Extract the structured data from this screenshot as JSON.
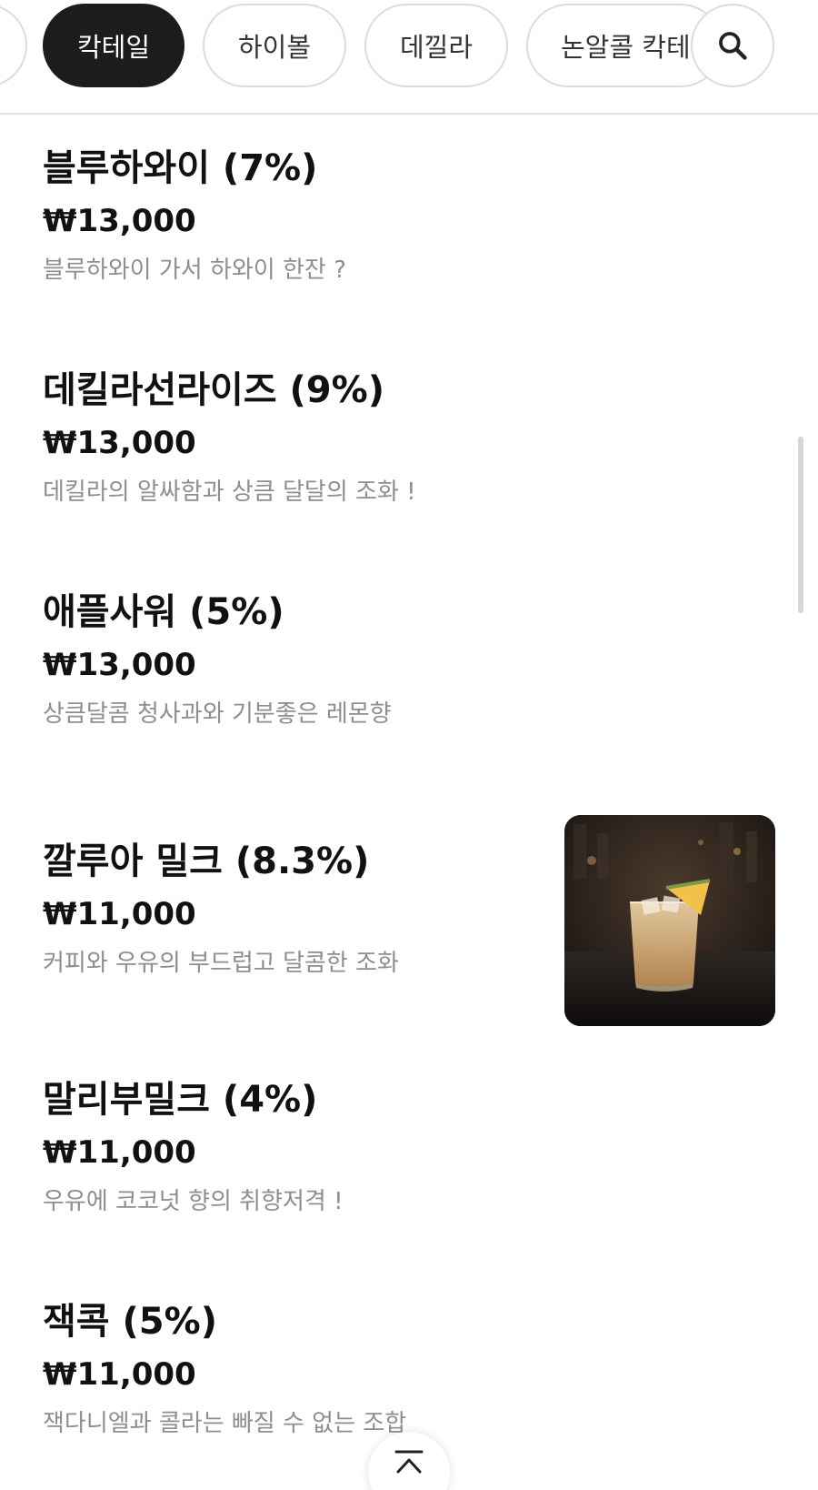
{
  "categories": [
    {
      "label": ""
    },
    {
      "label": "칵테일",
      "active": true
    },
    {
      "label": "하이볼"
    },
    {
      "label": "데낄라"
    },
    {
      "label": "논알콜 칵테"
    }
  ],
  "search": {
    "icon": "search-icon"
  },
  "menu": [
    {
      "name": "블루하와이 (7%)",
      "price": "₩13,000",
      "desc": "블루하와이 가서 하와이 한잔 ?"
    },
    {
      "name": "데킬라선라이즈 (9%)",
      "price": "₩13,000",
      "desc": "데킬라의 알싸함과 상큼 달달의 조화 !"
    },
    {
      "name": "애플사워 (5%)",
      "price": "₩13,000",
      "desc": "상큼달콤 청사과와 기분좋은 레몬향"
    },
    {
      "name": "깔루아 밀크 (8.3%)",
      "price": "₩11,000",
      "desc": "커피와 우유의 부드럽고 달콤한 조화",
      "photo": "cocktail-photo"
    },
    {
      "name": "말리부밀크 (4%)",
      "price": "₩11,000",
      "desc": "우유에 코코넛 향의 취향저격 !"
    },
    {
      "name": "잭콕 (5%)",
      "price": "₩11,000",
      "desc": "잭다니엘과 콜라는 빠질 수 없는 조합"
    }
  ],
  "colors": {
    "active_chip": "#1c1c1c",
    "desc_text": "#8e8e8e",
    "divider": "#e2e2e2"
  },
  "scroll_top": {
    "icon": "arrow-up-to-top-icon"
  }
}
